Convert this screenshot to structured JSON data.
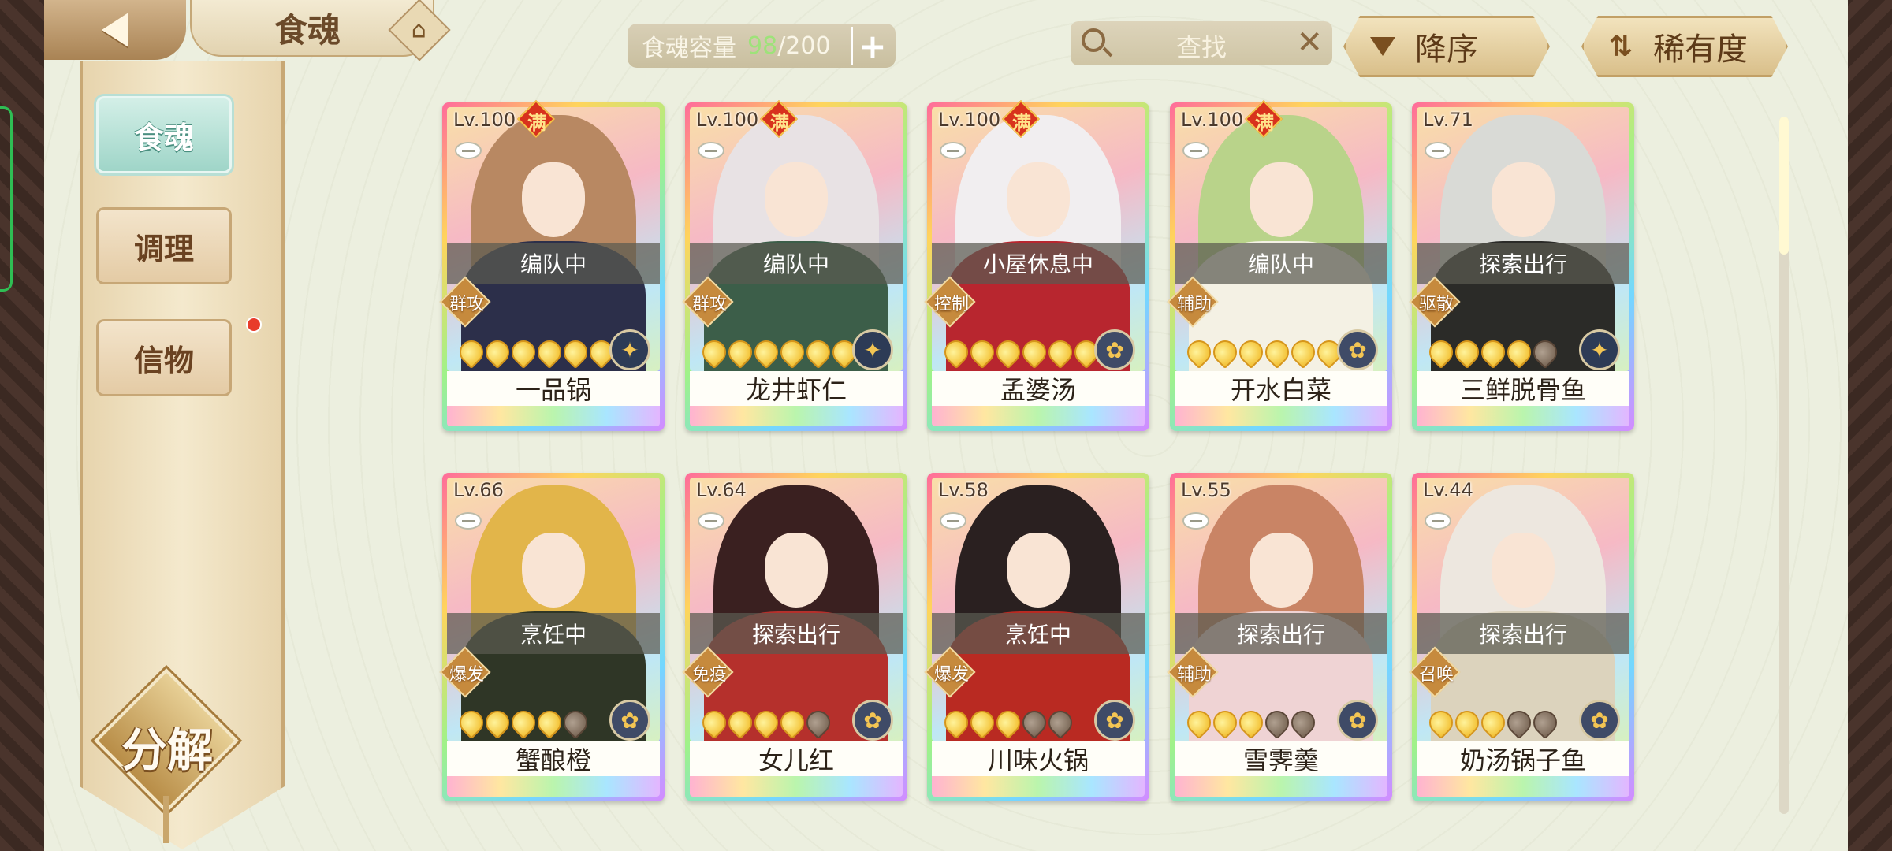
{
  "header": {
    "title": "食魂",
    "capacity_label": "食魂容量",
    "capacity_current": "98",
    "capacity_max": "/200",
    "add_label": "+",
    "search_text": "查找",
    "search_clear": "✕",
    "sort_order": "降序",
    "sort_key": "稀有度"
  },
  "sidebar": {
    "items": [
      {
        "label": "食魂",
        "active": true
      },
      {
        "label": "调理",
        "active": false
      },
      {
        "label": "信物",
        "active": false
      }
    ],
    "decompose": "分解"
  },
  "cards": [
    {
      "level": "Lv.100",
      "max": "满",
      "status": "编队中",
      "role": "群攻",
      "stars": 6,
      "filled": 6,
      "element": "gold",
      "name": "一品锅",
      "hair": "#b88862",
      "robe": "#2c2f4a"
    },
    {
      "level": "Lv.100",
      "max": "满",
      "status": "编队中",
      "role": "群攻",
      "stars": 6,
      "filled": 6,
      "element": "gold",
      "name": "龙井虾仁",
      "hair": "#e8e2e4",
      "robe": "#3c5e49"
    },
    {
      "level": "Lv.100",
      "max": "满",
      "status": "小屋休息中",
      "role": "控制",
      "stars": 6,
      "filled": 6,
      "element": "blue",
      "name": "孟婆汤",
      "hair": "#f1eef0",
      "robe": "#b8262f"
    },
    {
      "level": "Lv.100",
      "max": "满",
      "status": "编队中",
      "role": "辅助",
      "stars": 6,
      "filled": 6,
      "element": "blue",
      "name": "开水白菜",
      "hair": "#b9d38a",
      "robe": "#f4f1e4"
    },
    {
      "level": "Lv.71",
      "max": "",
      "status": "探索出行",
      "role": "驱散",
      "stars": 5,
      "filled": 4,
      "element": "gold",
      "name": "三鲜脱骨鱼",
      "hair": "#d9dad6",
      "robe": "#2b2b28"
    },
    {
      "level": "Lv.66",
      "max": "",
      "status": "烹饪中",
      "role": "爆发",
      "stars": 5,
      "filled": 4,
      "element": "blue",
      "name": "蟹酿橙",
      "hair": "#e2b54a",
      "robe": "#2f3626"
    },
    {
      "level": "Lv.64",
      "max": "",
      "status": "探索出行",
      "role": "免疫",
      "stars": 5,
      "filled": 4,
      "element": "blue",
      "name": "女儿红",
      "hair": "#3a2020",
      "robe": "#b5302c"
    },
    {
      "level": "Lv.58",
      "max": "",
      "status": "烹饪中",
      "role": "爆发",
      "stars": 5,
      "filled": 3,
      "element": "blue",
      "name": "川味火锅",
      "hair": "#2a2020",
      "robe": "#b92a22"
    },
    {
      "level": "Lv.55",
      "max": "",
      "status": "探索出行",
      "role": "辅助",
      "stars": 5,
      "filled": 3,
      "element": "blue",
      "name": "雪霁羹",
      "hair": "#c98465",
      "robe": "#efd3d4"
    },
    {
      "level": "Lv.44",
      "max": "",
      "status": "探索出行",
      "role": "召唤",
      "stars": 5,
      "filled": 3,
      "element": "blue",
      "name": "奶汤锅子鱼",
      "hair": "#ede7df",
      "robe": "#dcd3bd"
    }
  ],
  "icons": {
    "back": "back-arrow-icon",
    "home": "pagoda-icon",
    "search": "magnifier-icon",
    "sort": "triangle-down-icon",
    "rarity": "swap-arrows-icon"
  }
}
